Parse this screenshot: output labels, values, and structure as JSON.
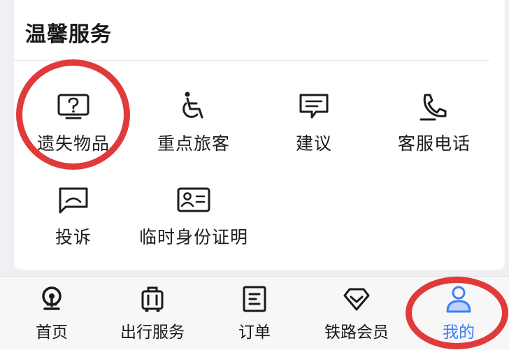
{
  "section": {
    "title": "温馨服务"
  },
  "services": [
    {
      "label": "遗失物品",
      "icon": "lost-item-icon"
    },
    {
      "label": "重点旅客",
      "icon": "wheelchair-icon"
    },
    {
      "label": "建议",
      "icon": "chat-bubble-icon"
    },
    {
      "label": "客服电话",
      "icon": "phone-icon"
    },
    {
      "label": "投诉",
      "icon": "complaint-icon"
    },
    {
      "label": "临时身份证明",
      "icon": "id-card-icon"
    }
  ],
  "tabs": [
    {
      "label": "首页",
      "icon": "train-logo-icon"
    },
    {
      "label": "出行服务",
      "icon": "luggage-icon"
    },
    {
      "label": "订单",
      "icon": "order-document-icon"
    },
    {
      "label": "铁路会员",
      "icon": "diamond-icon"
    },
    {
      "label": "我的",
      "icon": "user-icon",
      "active": true
    }
  ],
  "colors": {
    "accent": "#3d7ff5",
    "annotation_ring": "#e03a3a",
    "page_background": "#eef0f3",
    "card_background": "#ffffff"
  }
}
